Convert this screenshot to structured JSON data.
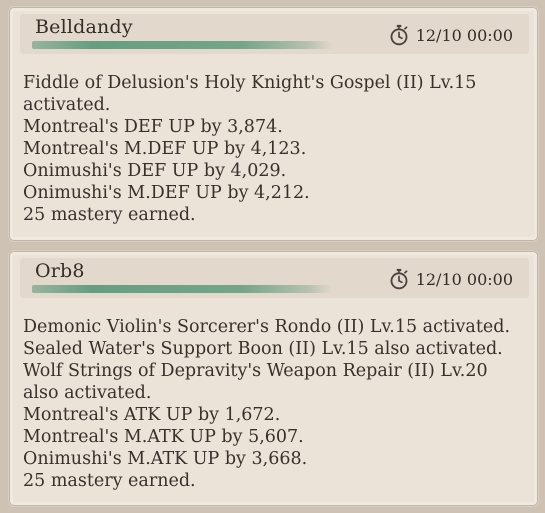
{
  "messages": [
    {
      "sender": "Belldandy",
      "time": "12/10 00:00",
      "icon": "stopwatch-icon",
      "lines": [
        "Fiddle of Delusion's Holy Knight's Gospel (II) Lv.15",
        "activated.",
        "Montreal's DEF UP by 3,874.",
        "Montreal's M.DEF UP by 4,123.",
        "Onimushi's DEF UP by 4,029.",
        "Onimushi's M.DEF UP by 4,212.",
        "25 mastery earned."
      ]
    },
    {
      "sender": "Orb8",
      "time": "12/10 00:00",
      "icon": "stopwatch-icon",
      "lines": [
        "Demonic Violin's Sorcerer's Rondo (II) Lv.15 activated.",
        "Sealed Water's Support Boon (II) Lv.15 also activated.",
        "Wolf Strings of Depravity's Weapon Repair (II) Lv.20",
        "also activated.",
        "Montreal's ATK UP by 1,672.",
        "Montreal's M.ATK UP by 5,607.",
        "Onimushi's M.ATK UP by 3,668.",
        "25 mastery earned."
      ]
    }
  ],
  "colors": {
    "background": "#cdc2b4",
    "card": "#ebe2d8",
    "name_bar": "#5f9b7d",
    "text": "#38312b"
  }
}
